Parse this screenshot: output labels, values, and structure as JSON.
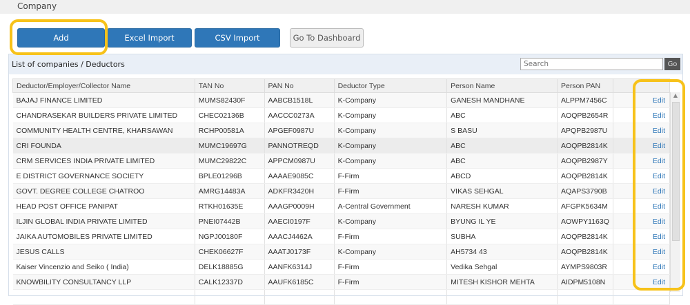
{
  "header": {
    "title": "Company"
  },
  "toolbar": {
    "add": "Add",
    "excel": "Excel Import",
    "csv": "CSV Import",
    "dashboard": "Go To Dashboard"
  },
  "panel": {
    "title": "List of companies / Deductors",
    "search_placeholder": "Search",
    "go": "Go"
  },
  "columns": [
    "Deductor/Employer/Collector Name",
    "TAN No",
    "PAN No",
    "Deductor Type",
    "Person Name",
    "Person PAN",
    ""
  ],
  "edit_label": "Edit",
  "rows": [
    [
      "BAJAJ FINANCE LIMITED",
      "MUMS82430F",
      "AABCB1518L",
      "K-Company",
      "GANESH MANDHANE",
      "ALPPM7456C"
    ],
    [
      "CHANDRASEKAR BUILDERS PRIVATE LIMITED",
      "CHEC02136B",
      "AACCC0273A",
      "K-Company",
      "ABC",
      "AOQPB2654R"
    ],
    [
      "COMMUNITY HEALTH CENTRE, KHARSAWAN",
      "RCHP00581A",
      "APGEF0987U",
      "K-Company",
      "S BASU",
      "APQPB2987U"
    ],
    [
      "CRI FOUNDA",
      "MUMC19697G",
      "PANNOTREQD",
      "K-Company",
      "ABC",
      "AOQPB2814K"
    ],
    [
      "CRM SERVICES INDIA PRIVATE LIMITED",
      "MUMC29822C",
      "APPCM0987U",
      "K-Company",
      "ABC",
      "AOQPB2987Y"
    ],
    [
      "E DISTRICT GOVERNANCE SOCIETY",
      "BPLE01296B",
      "AAAAE9085C",
      "F-Firm",
      "ABCD",
      "AOQPB2814K"
    ],
    [
      "GOVT. DEGREE COLLEGE CHATROO",
      "AMRG14483A",
      "ADKFR3420H",
      "F-Firm",
      "VIKAS SEHGAL",
      "AQAPS3790B"
    ],
    [
      "HEAD POST OFFICE PANIPAT",
      "RTKH01635E",
      "AAAGP0009H",
      "A-Central Government",
      "NARESH KUMAR",
      "AFGPK5634M"
    ],
    [
      "ILJIN GLOBAL INDIA PRIVATE LIMITED",
      "PNEI07442B",
      "AAECI0197F",
      "K-Company",
      "BYUNG IL YE",
      "AOWPY1163Q"
    ],
    [
      "JAIKA AUTOMOBILES PRIVATE LIMITED",
      "NGPJ00180F",
      "AAACJ4462A",
      "F-Firm",
      "SUBHA",
      "AOQPB2814K"
    ],
    [
      "JESUS CALLS",
      "CHEK06627F",
      "AAATJ0173F",
      "K-Company",
      "AH5734 43",
      "AOQPB2814K"
    ],
    [
      "Kaiser Vincenzio and Seiko ( India)",
      "DELK18885G",
      "AANFK6314J",
      "F-Firm",
      "Vedika Sehgal",
      "AYMPS9803R"
    ],
    [
      "KNOWBILITY CONSULTANCY LLP",
      "CALK12337D",
      "AAUFK6185C",
      "F-Firm",
      "MITESH KISHOR MEHTA",
      "AIDPM5108N"
    ]
  ]
}
